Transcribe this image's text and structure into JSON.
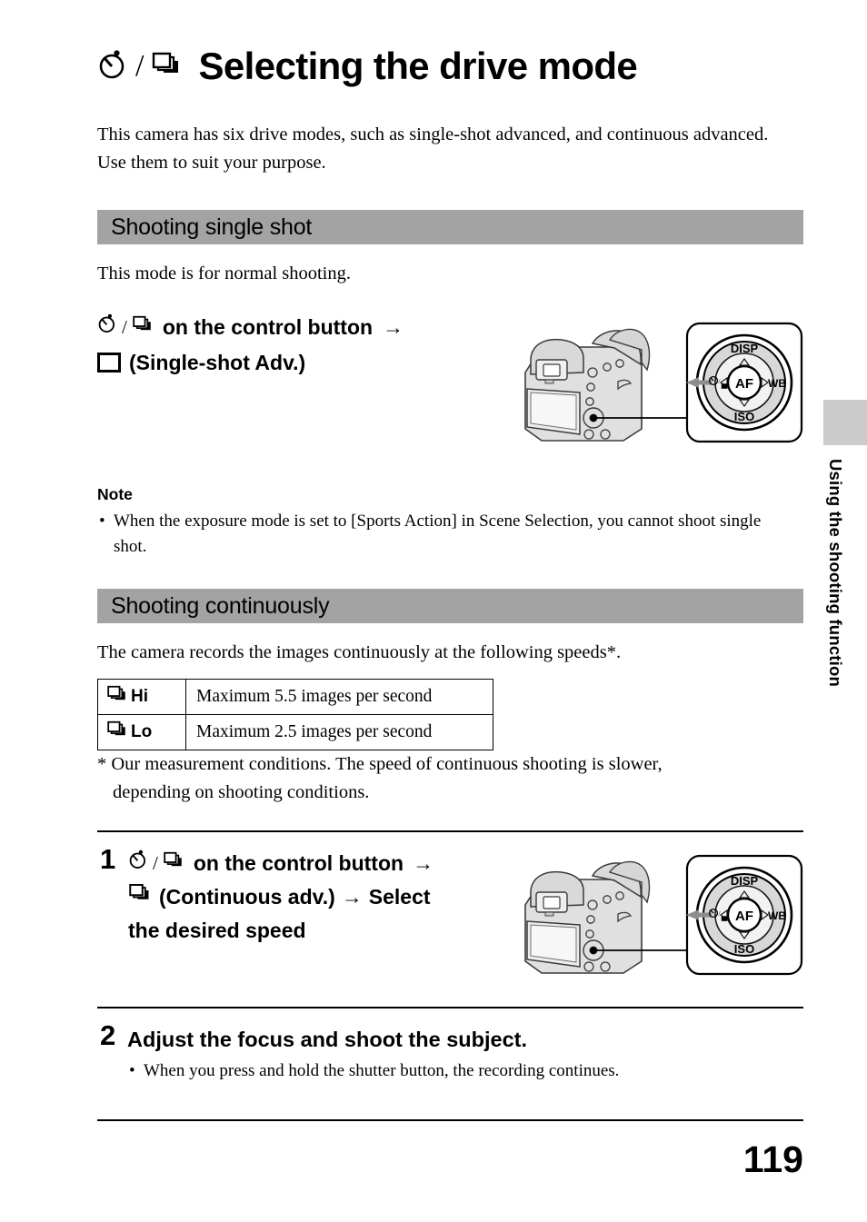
{
  "document": {
    "page_number": "119",
    "side_tab_label": "Using the shooting function"
  },
  "title": {
    "icon_timer": "self-timer-icon",
    "separator": "/",
    "icon_burst": "continuous-drive-icon",
    "text": "Selecting the drive mode"
  },
  "intro": {
    "text": "This camera has six drive modes, such as single-shot advanced, and continuous advanced. Use them to suit your purpose."
  },
  "section_single": {
    "header": "Shooting single shot",
    "description": "This mode is for normal shooting.",
    "instruction_line1_suffix": "on the control button",
    "arrow": "→",
    "instruction_line2": "(Single-shot Adv.)",
    "note_heading": "Note",
    "note_bullet": "When the exposure mode is set to [Sports Action] in Scene Selection, you cannot shoot single shot."
  },
  "section_continuous": {
    "header": "Shooting continuously",
    "description": "The camera records the images continuously at the following speeds*.",
    "table": {
      "rows": [
        {
          "mode": "Hi",
          "mode_icon": "continuous-hi-icon",
          "value": "Maximum 5.5 images per second"
        },
        {
          "mode": "Lo",
          "mode_icon": "continuous-lo-icon",
          "value": "Maximum 2.5 images per second"
        }
      ]
    },
    "footnote_line1": "* Our measurement conditions. The speed of continuous shooting is slower,",
    "footnote_line2": "depending on shooting conditions."
  },
  "steps": [
    {
      "number": "1",
      "line1_suffix": "on the control button",
      "arrow": "→",
      "line2": "(Continuous adv.)",
      "arrow2": "→",
      "line2_tail": "Select",
      "line3": "the desired speed"
    },
    {
      "number": "2",
      "text": "Adjust the focus and shoot the subject.",
      "bullet": "When you press and hold the shutter button, the recording continues."
    }
  ],
  "figures": {
    "control_dial": {
      "label_top": "DISP",
      "label_right": "WB",
      "label_bottom": "ISO",
      "label_center": "AF",
      "label_left_icon": "drive-mode-icon"
    }
  },
  "colors": {
    "section_bar": "#a3a3a3",
    "side_tab": "#cbcbcb",
    "text": "#000000",
    "page_background": "#ffffff"
  }
}
